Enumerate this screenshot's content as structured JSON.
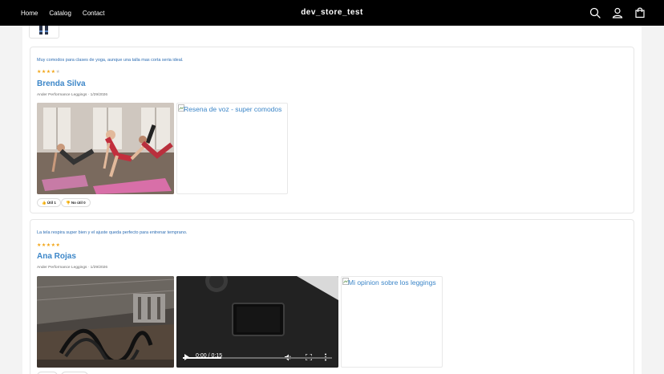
{
  "header": {
    "nav": [
      "Home",
      "Catalog",
      "Contact"
    ],
    "brand": "dev_store_test",
    "icons": [
      "search-icon",
      "account-icon",
      "cart-icon"
    ]
  },
  "reviews": [
    {
      "comment": "Muy comodos para clases de yoga, aunque una talla mas corta seria ideal.",
      "rating": 4,
      "max_rating": 5,
      "author": "Brenda Silva",
      "meta": "Ander Performance Leggings · 1/29/2026",
      "broken_media_alt": "Resena de voz - super comodos",
      "helpful_label": "👍 Útil 1",
      "not_helpful_label": "👎 No útil 0"
    },
    {
      "comment": "La tela respira super bien y el ajuste queda perfecto para entrenar temprano.",
      "rating": 5,
      "max_rating": 5,
      "author": "Ana Rojas",
      "meta": "Ander Performance Leggings · 1/29/2026",
      "video_time": "0:00 / 0:15",
      "video_progress": 0.26,
      "broken_media_alt": "Mi opinion sobre los leggings"
    }
  ],
  "colors": {
    "header_bg": "#000000",
    "link_blue": "#3c86c8",
    "star": "#f2a516"
  }
}
